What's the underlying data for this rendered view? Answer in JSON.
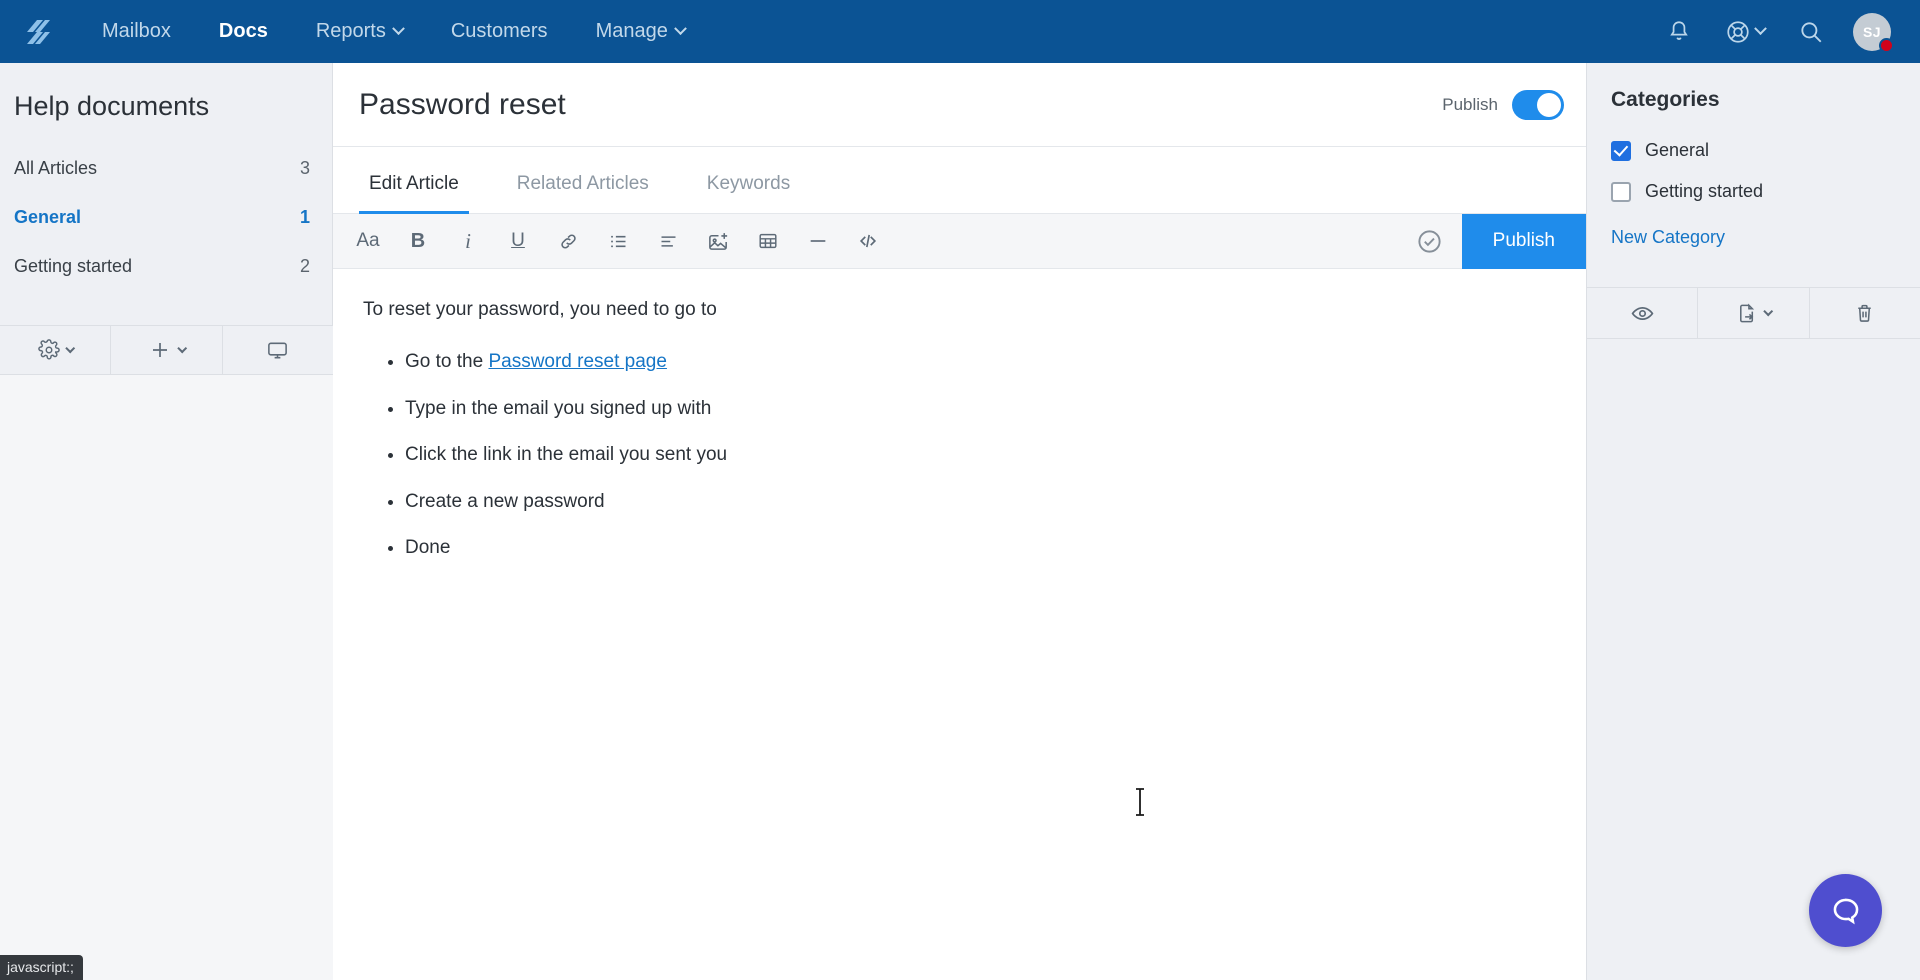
{
  "topnav": {
    "logo_icon": "helpscout-logo-icon",
    "brand_color": "#0b5394",
    "items": [
      {
        "label": "Mailbox",
        "active": false,
        "has_chevron": false
      },
      {
        "label": "Docs",
        "active": true,
        "has_chevron": false
      },
      {
        "label": "Reports",
        "active": false,
        "has_chevron": true
      },
      {
        "label": "Customers",
        "active": false,
        "has_chevron": false
      },
      {
        "label": "Manage",
        "active": false,
        "has_chevron": true
      }
    ],
    "right_icons": [
      {
        "name": "bell-icon"
      },
      {
        "name": "lifering-help-icon"
      },
      {
        "name": "search-icon"
      }
    ],
    "avatar_initials": "SJ",
    "avatar_badge_color": "#d0021b"
  },
  "sidebar": {
    "title": "Help documents",
    "items": [
      {
        "label": "All Articles",
        "count": "3",
        "selected": false
      },
      {
        "label": "General",
        "count": "1",
        "selected": true
      },
      {
        "label": "Getting started",
        "count": "2",
        "selected": false
      }
    ],
    "tools": [
      {
        "name": "settings-gear-icon",
        "has_chevron": true
      },
      {
        "name": "add-plus-icon",
        "has_chevron": true
      },
      {
        "name": "monitor-preview-icon",
        "has_chevron": false
      }
    ]
  },
  "editor": {
    "article_title": "Password reset",
    "publish_label": "Publish",
    "publish_toggle_on": true,
    "toggle_color": "#1f8ceb",
    "tabs": [
      {
        "label": "Edit Article",
        "active": true
      },
      {
        "label": "Related Articles",
        "active": false
      },
      {
        "label": "Keywords",
        "active": false
      }
    ],
    "toolbar": [
      {
        "name": "font-size-icon",
        "glyph": "Aa"
      },
      {
        "name": "bold-icon",
        "glyph": "B"
      },
      {
        "name": "italic-icon",
        "glyph": "i"
      },
      {
        "name": "underline-icon",
        "glyph": "U"
      },
      {
        "name": "link-icon",
        "glyph": ""
      },
      {
        "name": "bullet-list-icon",
        "glyph": ""
      },
      {
        "name": "align-left-icon",
        "glyph": ""
      },
      {
        "name": "insert-image-icon",
        "glyph": ""
      },
      {
        "name": "insert-table-icon",
        "glyph": ""
      },
      {
        "name": "horizontal-rule-icon",
        "glyph": ""
      },
      {
        "name": "code-block-icon",
        "glyph": ""
      }
    ],
    "save_status_icon": "saved-check-circle-icon",
    "publish_button_label": "Publish",
    "publish_button_color": "#1f8ceb",
    "content": {
      "paragraph": "To reset your password, you need to go to",
      "list": [
        {
          "prefix": "Go to the ",
          "link": "Password reset page",
          "suffix": ""
        },
        {
          "prefix": "Type in the email you signed up with",
          "link": "",
          "suffix": ""
        },
        {
          "prefix": "Click the link in the email you sent you",
          "link": "",
          "suffix": ""
        },
        {
          "prefix": "Create a new password",
          "link": "",
          "suffix": ""
        },
        {
          "prefix": "Done",
          "link": "",
          "suffix": ""
        }
      ]
    }
  },
  "categories_panel": {
    "title": "Categories",
    "items": [
      {
        "label": "General",
        "checked": true
      },
      {
        "label": "Getting started",
        "checked": false
      }
    ],
    "new_category_label": "New Category",
    "tools": [
      {
        "name": "eye-preview-icon",
        "has_chevron": false
      },
      {
        "name": "move-article-icon",
        "has_chevron": true
      },
      {
        "name": "trash-delete-icon",
        "has_chevron": false
      }
    ]
  },
  "floating": {
    "beacon_icon": "chat-bubble-icon",
    "beacon_color": "#4f4ecf"
  },
  "status_bar": {
    "text": "javascript:;"
  }
}
